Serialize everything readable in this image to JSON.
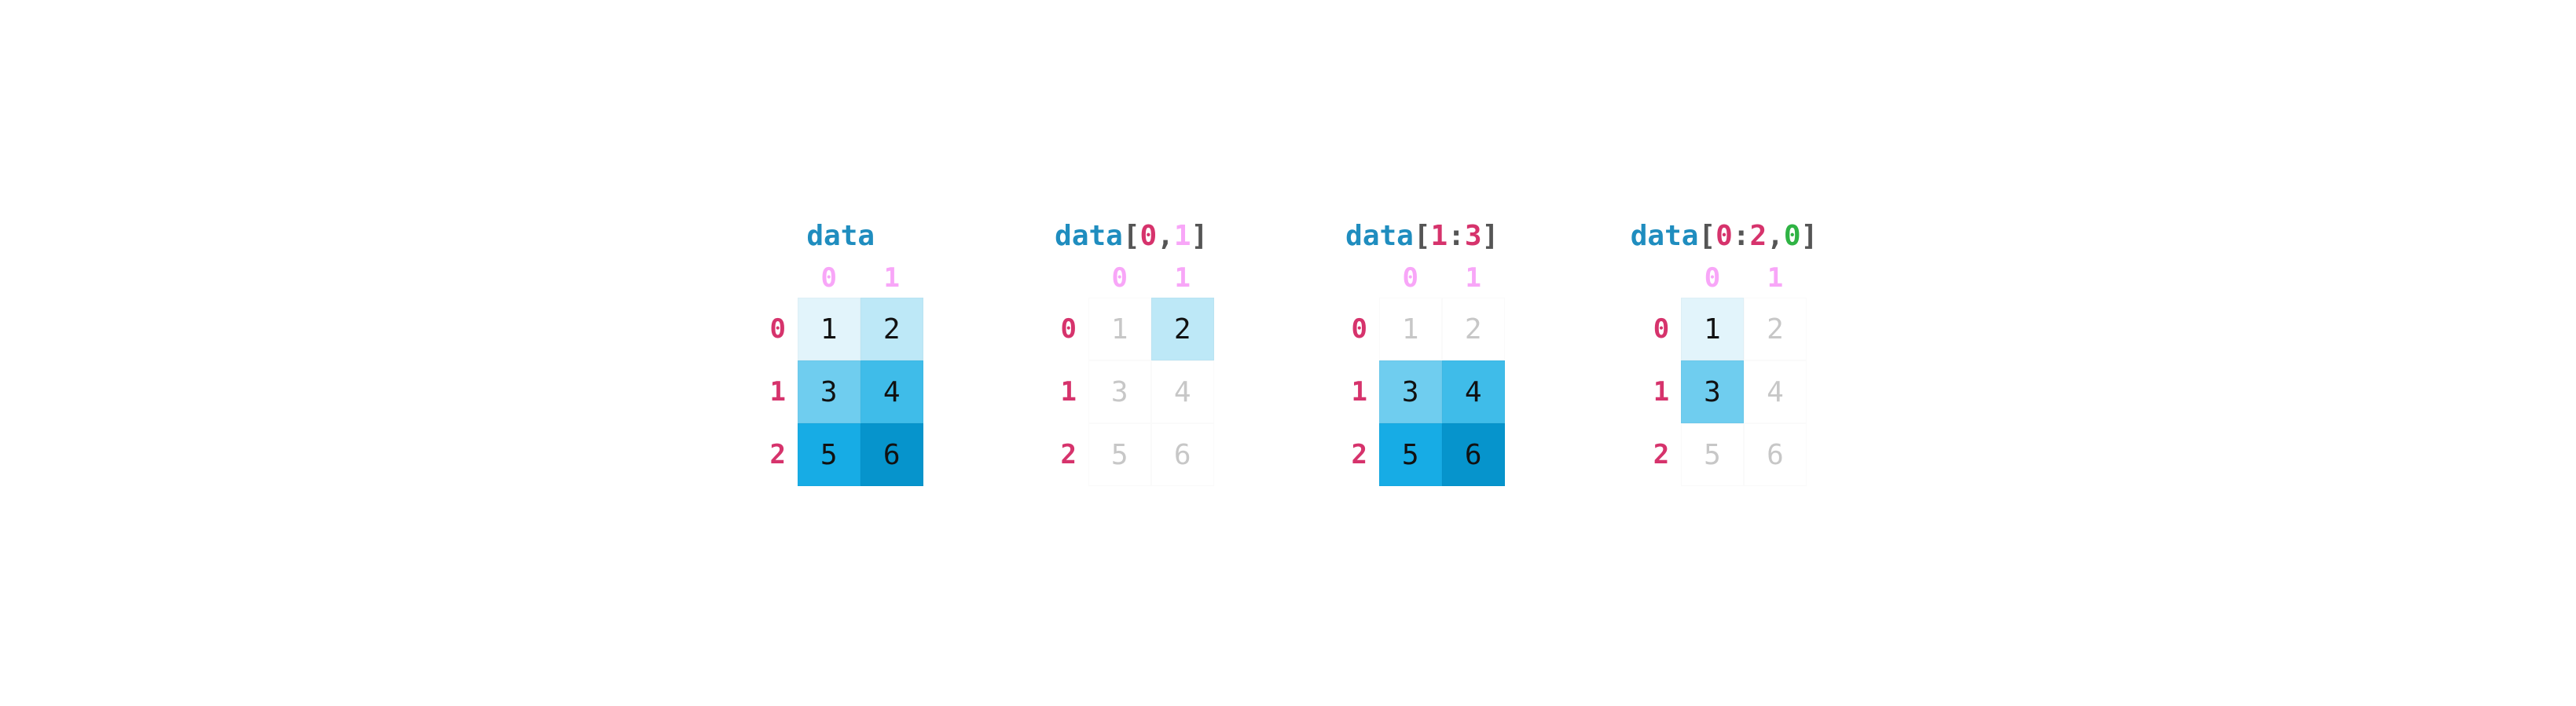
{
  "row_labels": [
    "0",
    "1",
    "2"
  ],
  "col_labels": [
    "0",
    "1"
  ],
  "grid_values": [
    "1",
    "2",
    "3",
    "4",
    "5",
    "6"
  ],
  "cell_shades": [
    "b1",
    "b2",
    "b3",
    "b4",
    "b5",
    "b6"
  ],
  "panels": [
    {
      "title_parts": [
        {
          "text": "data",
          "cls": "t-blue"
        }
      ],
      "active": [
        true,
        true,
        true,
        true,
        true,
        true
      ]
    },
    {
      "title_parts": [
        {
          "text": "data",
          "cls": "t-blue"
        },
        {
          "text": "[",
          "cls": "t-gray"
        },
        {
          "text": "0",
          "cls": "t-pink"
        },
        {
          "text": ",",
          "cls": "t-gray"
        },
        {
          "text": "1",
          "cls": "t-violet"
        },
        {
          "text": "]",
          "cls": "t-gray"
        }
      ],
      "active": [
        false,
        true,
        false,
        false,
        false,
        false
      ]
    },
    {
      "title_parts": [
        {
          "text": "data",
          "cls": "t-blue"
        },
        {
          "text": "[",
          "cls": "t-gray"
        },
        {
          "text": "1",
          "cls": "t-pink"
        },
        {
          "text": ":",
          "cls": "t-gray"
        },
        {
          "text": "3",
          "cls": "t-pink"
        },
        {
          "text": "]",
          "cls": "t-gray"
        }
      ],
      "active": [
        false,
        false,
        true,
        true,
        true,
        true
      ]
    },
    {
      "title_parts": [
        {
          "text": "data",
          "cls": "t-blue"
        },
        {
          "text": "[",
          "cls": "t-gray"
        },
        {
          "text": "0",
          "cls": "t-pink"
        },
        {
          "text": ":",
          "cls": "t-gray"
        },
        {
          "text": "2",
          "cls": "t-pink"
        },
        {
          "text": ",",
          "cls": "t-gray"
        },
        {
          "text": "0",
          "cls": "t-green"
        },
        {
          "text": "]",
          "cls": "t-gray"
        }
      ],
      "active": [
        true,
        false,
        true,
        false,
        false,
        false
      ]
    }
  ]
}
